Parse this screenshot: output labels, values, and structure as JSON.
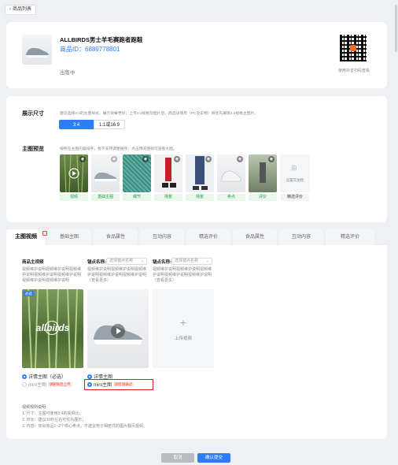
{
  "nav": {
    "back_label": "商品列表"
  },
  "product": {
    "title": "ALLBIRDS男士羊毛赛跑者跑鞋",
    "id_text": "商品ID：6889778801",
    "status": "出售中",
    "qr_caption": "使用抖音扫码查看"
  },
  "display_size": {
    "label": "展示尺寸",
    "hint": "建议选择3:4的主图样式，展示效果更好；上传3:4规格及图片后，商品详情页（PC及实物）将优先展现3:4规格主图片。",
    "options": [
      "3:4",
      "1:1或16:9"
    ],
    "selected": "3:4"
  },
  "preview": {
    "label": "主图预览",
    "hint": "按所在主图内容排序，暂不支持调整顺序；点击预览图标可查看大图。",
    "items": [
      {
        "tag": "视频"
      },
      {
        "tag": "基础主图"
      },
      {
        "tag": "细节"
      },
      {
        "tag": "场景"
      },
      {
        "tag": "场景"
      },
      {
        "tag": "卖点"
      },
      {
        "tag": "评价"
      }
    ],
    "placeholder_label": "设置实拍售",
    "placeholder_tag": "精选评价"
  },
  "tabs": {
    "items": [
      "主图视频",
      "基础主图",
      "食品属性",
      "互动内容",
      "精选评价",
      "食品属性",
      "互动内容",
      "精选评价"
    ],
    "active_index": 0
  },
  "video_panel": {
    "columns": [
      {
        "header": "商品主视频",
        "desc": "视频维护说明视频维护说明视频维护说明视频维护说明视频维护说明视频维护说明视频维护说明"
      },
      {
        "header": "锚点名称:",
        "select_placeholder": "选择锚点名称",
        "desc": "视频维护说明视频维护说明视频维护说明视频维护说明视频维护说明（查看更多）"
      },
      {
        "header": "锚点名称:",
        "select_placeholder": "选择锚点名称",
        "desc": "视频维护说明视频维护说明视频维护说明视频维护说明视频维护说明（查看更多）"
      }
    ],
    "video_badge": "必选",
    "video_brand": "allbirds",
    "upload_label": "上传视频",
    "options": {
      "detail_main": "详情主图（必选）",
      "mini_main_left": "mini主图",
      "mini_left_badge": "请删除后上传",
      "detail_main_right": "详情主图",
      "mini_main_right": "mini主图",
      "mini_right_badge": "请检测通过"
    },
    "notes_title": "视频规则说明:",
    "notes": [
      "1. 尺寸：主图可使用3:4的视频比；",
      "2. 时长：建议30秒左右可优先展示；",
      "3. 内容：突出商品1~2个核心卖点，不建议电子相册式的图片翻页视频。"
    ]
  },
  "footer": {
    "cancel_label": "取消",
    "submit_label": "确认提交"
  },
  "colors": {
    "primary": "#2e7cf6",
    "highlight_border": "#e0201e",
    "tag_green": "#2a9d43"
  }
}
